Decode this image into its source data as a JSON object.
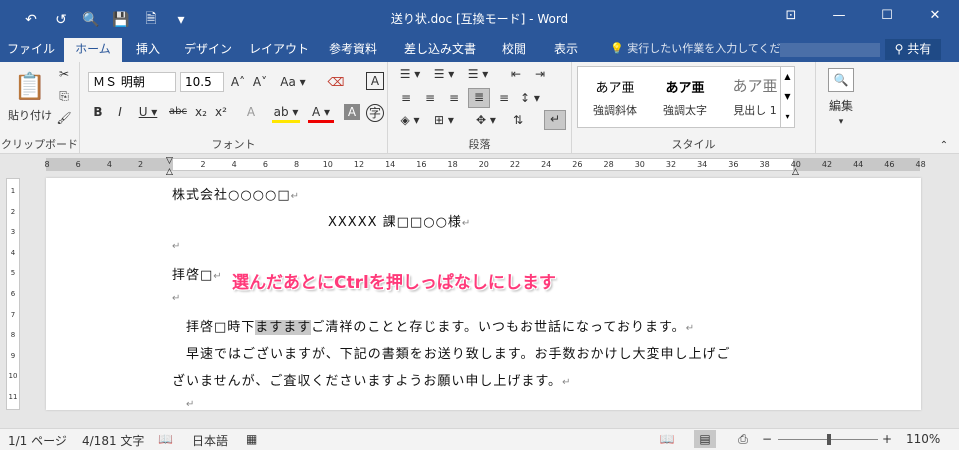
{
  "window": {
    "title": "送り状.doc [互換モード] - Word",
    "qat": [
      "↶",
      "↺",
      "🔍",
      "💾",
      "🗎",
      "▾"
    ],
    "controls": [
      "⊡",
      "—",
      "☐",
      "✕"
    ]
  },
  "tabs": [
    "ファイル",
    "ホーム",
    "挿入",
    "デザイン",
    "レイアウト",
    "参考資料",
    "差し込み文書",
    "校閲",
    "表示"
  ],
  "tell_me": "実行したい作業を入力してくださ",
  "share": "共有",
  "ribbon": {
    "clipboard": {
      "paste_label": "貼り付け",
      "group_label": "クリップボード"
    },
    "font": {
      "name": "ＭＳ 明朝",
      "size": "10.5",
      "group_label": "フォント",
      "row1": [
        "A˄",
        "A˅",
        "Aa ▾",
        "⌫",
        "A"
      ],
      "row2": [
        "B",
        "I",
        "U ▾",
        "abc",
        "x₂",
        "x²"
      ],
      "row3": [
        "A",
        "ab ▾",
        "A ▾",
        "A",
        "字"
      ]
    },
    "paragraph": {
      "group_label": "段落",
      "row1": [
        "☰ ▾",
        "☰ ▾",
        "☰ ▾",
        "⇤",
        "⇥"
      ],
      "row2": [
        "≡",
        "≡",
        "≡",
        "≣",
        "≡",
        "↕ ▾"
      ],
      "row3": [
        "◈ ▾",
        "⊞ ▾",
        "✥ ▾",
        "⇅",
        "↵"
      ]
    },
    "styles": {
      "group_label": "スタイル",
      "items": [
        {
          "sample": "あア亜",
          "name": "強調斜体"
        },
        {
          "sample": "あア亜",
          "name": "強調太字"
        },
        {
          "sample": "あア亜",
          "name": "見出し 1"
        }
      ]
    },
    "editing": {
      "label": "編集"
    }
  },
  "ruler": {
    "numbers": [
      "8",
      "6",
      "4",
      "2",
      "",
      "2",
      "4",
      "6",
      "8",
      "10",
      "12",
      "14",
      "16",
      "18",
      "20",
      "22",
      "24",
      "26",
      "28",
      "30",
      "32",
      "34",
      "36",
      "38",
      "40",
      "42",
      "44",
      "46",
      "48"
    ],
    "vertical": [
      "1",
      "2",
      "3",
      "4",
      "5",
      "6",
      "7",
      "8",
      "9",
      "10",
      "11"
    ]
  },
  "document": {
    "line1": "株式会社○○○○□",
    "line2": "XXXXX 課□□○○様",
    "line3": "拝啓□",
    "line4_pre": "拝啓□時下",
    "line4_sel": "ますます",
    "line4_post": "ご清祥のことと存じます。いつもお世話になっております。",
    "line5": "早速ではございますが、下記の書類をお送り致します。お手数おかけし大変申し上げご",
    "line6": "ざいませんが、ご査収くださいますようお願い申し上げます。",
    "para_mark": "↵"
  },
  "annotation": "選んだあとにCtrlを押しっぱなしにします",
  "status": {
    "page": "1/1 ページ",
    "words": "4/181 文字",
    "language": "日本語",
    "zoom": "110%",
    "zoom_level_percent": 110
  }
}
